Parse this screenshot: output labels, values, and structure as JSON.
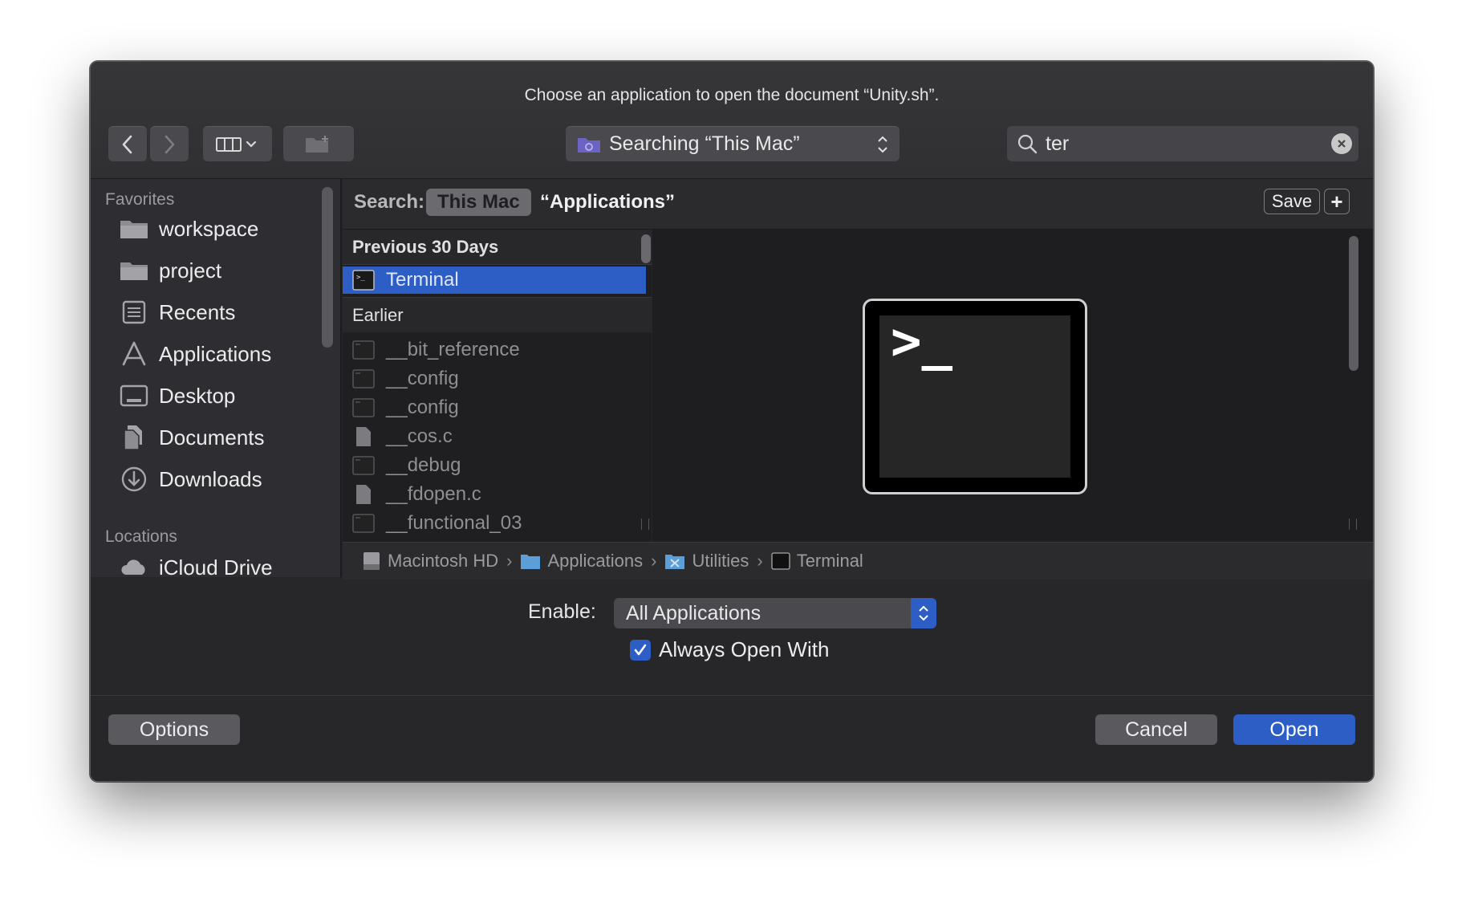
{
  "dialog": {
    "title": "Choose an application to open the document “Unity.sh”."
  },
  "toolbar": {
    "back_icon": "chevron-left-icon",
    "forward_icon": "chevron-right-icon",
    "view_icon": "column-view-icon",
    "new_folder_icon": "new-folder-icon",
    "location_label": "Searching “This Mac”",
    "search_value": "ter"
  },
  "sidebar": {
    "favorites_heading": "Favorites",
    "locations_heading": "Locations",
    "items": [
      {
        "label": "workspace",
        "icon": "folder-icon"
      },
      {
        "label": "project",
        "icon": "folder-icon"
      },
      {
        "label": "Recents",
        "icon": "recents-icon"
      },
      {
        "label": "Applications",
        "icon": "applications-icon"
      },
      {
        "label": "Desktop",
        "icon": "desktop-icon"
      },
      {
        "label": "Documents",
        "icon": "documents-icon"
      },
      {
        "label": "Downloads",
        "icon": "downloads-icon"
      }
    ],
    "location_items": [
      {
        "label": "iCloud Drive",
        "icon": "cloud-icon"
      }
    ]
  },
  "scope": {
    "label": "Search:",
    "this_mac": "This Mac",
    "applications": "“Applications”",
    "save": "Save",
    "add": "+"
  },
  "results": {
    "group_recent": "Previous 30 Days",
    "selected": "Terminal",
    "group_earlier": "Earlier",
    "earlier_items": [
      {
        "label": "__bit_reference",
        "kind": "exec"
      },
      {
        "label": "__config",
        "kind": "exec"
      },
      {
        "label": "__config",
        "kind": "exec"
      },
      {
        "label": "__cos.c",
        "kind": "doc"
      },
      {
        "label": "__debug",
        "kind": "exec"
      },
      {
        "label": "__fdopen.c",
        "kind": "doc"
      },
      {
        "label": "__functional_03",
        "kind": "exec"
      }
    ]
  },
  "preview": {
    "icon": "terminal-app-icon",
    "prompt": ">_"
  },
  "pathbar": {
    "segments": [
      "Macintosh HD",
      "Applications",
      "Utilities",
      "Terminal"
    ]
  },
  "options": {
    "enable_label": "Enable:",
    "enable_value": "All Applications",
    "always_open_with": "Always Open With",
    "always_open_checked": true
  },
  "buttons": {
    "options": "Options",
    "cancel": "Cancel",
    "open": "Open"
  },
  "colors": {
    "accent": "#2d5ec6",
    "selection": "#2d5ec6"
  }
}
